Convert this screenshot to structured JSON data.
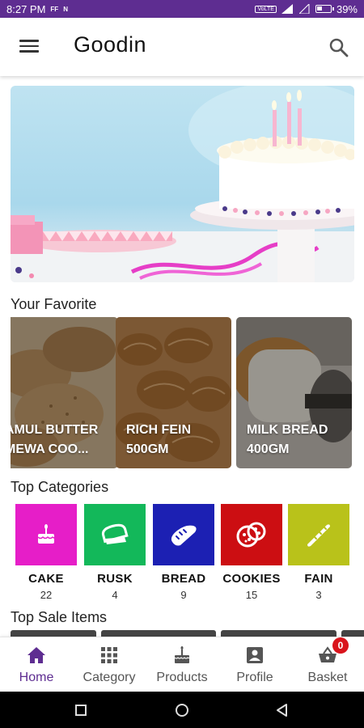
{
  "status_bar": {
    "time": "8:27 PM",
    "indicators": [
      "FF",
      "N"
    ],
    "volte": "VoLTE",
    "battery": "39%"
  },
  "app_bar": {
    "title": "Goodin",
    "menu_icon": "hamburger-menu-icon",
    "search_icon": "search-icon"
  },
  "banner": {
    "image": "birthday-cake-with-candles"
  },
  "favorites": {
    "title": "Your Favorite",
    "items": [
      {
        "name": "AMUL BUTTER\nMEWA COO...",
        "image": "cookies"
      },
      {
        "name": "RICH FEIN\n500GM",
        "image": "puff-pastry"
      },
      {
        "name": "MILK BREAD\n400GM",
        "image": "bread-loaf"
      }
    ]
  },
  "categories": {
    "title": "Top Categories",
    "items": [
      {
        "label": "CAKE",
        "count": "22",
        "color": "#e61ec8",
        "icon": "cake-icon"
      },
      {
        "label": "RUSK",
        "count": "4",
        "color": "#13b85a",
        "icon": "toast-icon"
      },
      {
        "label": "BREAD",
        "count": "9",
        "color": "#1c20b3",
        "icon": "bread-icon"
      },
      {
        "label": "COOKIES",
        "count": "15",
        "color": "#cc0e12",
        "icon": "cookie-icon"
      },
      {
        "label": "FAIN",
        "count": "3",
        "color": "#b9c21a",
        "icon": "baguette-icon"
      }
    ]
  },
  "top_sale": {
    "title": "Top Sale Items"
  },
  "bottom_nav": {
    "items": [
      {
        "label": "Home",
        "icon": "home-icon",
        "active": true
      },
      {
        "label": "Category",
        "icon": "grid-icon",
        "active": false
      },
      {
        "label": "Products",
        "icon": "products-cake-icon",
        "active": false
      },
      {
        "label": "Profile",
        "icon": "profile-icon",
        "active": false
      },
      {
        "label": "Basket",
        "icon": "basket-icon",
        "active": false,
        "badge": "0"
      }
    ],
    "active_color": "#5e2d91"
  },
  "colors": {
    "status_bar": "#5e2d91",
    "accent": "#5e2d91"
  }
}
